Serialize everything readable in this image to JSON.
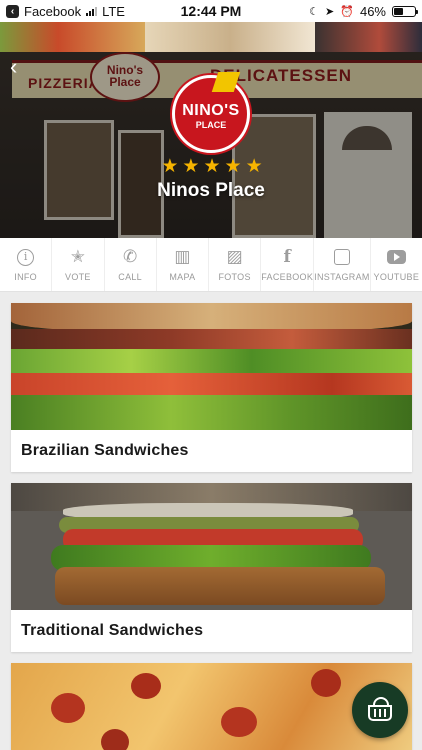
{
  "status_bar": {
    "back_app": "Facebook",
    "carrier": "LTE",
    "time": "12:44 PM",
    "battery": "46%",
    "battery_level": 0.46
  },
  "header": {
    "back_label": "‹",
    "logo_line1": "NINO'S",
    "logo_line2": "PLACE",
    "storefront_sign_left": "PIZZERIA",
    "storefront_sign_oval": "Nino's Place",
    "storefront_sign_right": "DELICATESSEN",
    "rating_stars": 5,
    "place_name": "Ninos Place"
  },
  "tabs": [
    {
      "label": "INFO",
      "icon": "info-icon"
    },
    {
      "label": "VOTE",
      "icon": "star-icon"
    },
    {
      "label": "CALL",
      "icon": "phone-icon"
    },
    {
      "label": "MAPA",
      "icon": "map-icon"
    },
    {
      "label": "FOTOS",
      "icon": "photos-icon"
    },
    {
      "label": "FACEBOOK",
      "icon": "facebook-icon"
    },
    {
      "label": "INSTAGRAM",
      "icon": "instagram-icon"
    },
    {
      "label": "YOUTUBE",
      "icon": "youtube-icon"
    }
  ],
  "categories": [
    {
      "title": "Brazilian Sandwiches"
    },
    {
      "title": "Traditional Sandwiches"
    },
    {
      "title": ""
    }
  ],
  "cart": {
    "icon": "basket-icon"
  }
}
